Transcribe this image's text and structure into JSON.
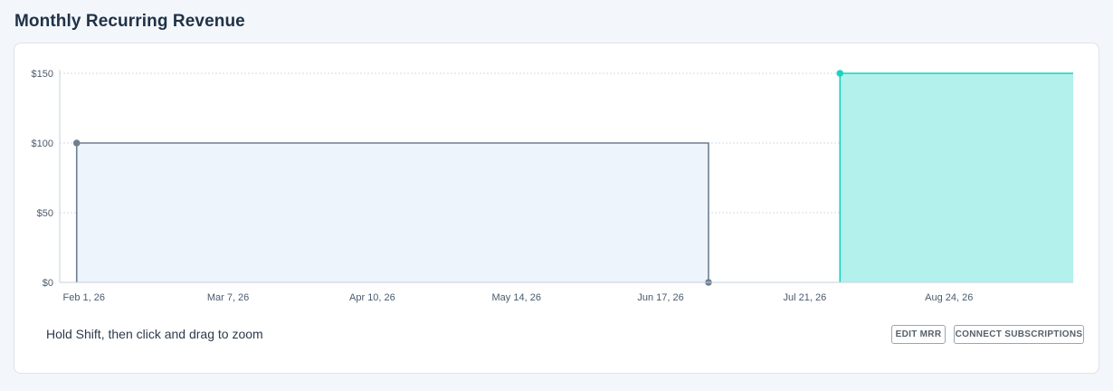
{
  "page": {
    "title": "Monthly Recurring Revenue"
  },
  "footer": {
    "hint": "Hold Shift, then click and drag to zoom",
    "buttons": {
      "edit_mrr": "EDIT MRR",
      "connect_subscriptions": "CONNECT SUBSCRIPTIONS"
    }
  },
  "colors": {
    "series_1_line": "#6e7f90",
    "series_1_fill": "#edf4fc",
    "series_2_line": "#19d3bf",
    "series_2_fill": "#b3f1ed",
    "grid": "#d6dde4",
    "axis": "#c7d0d8"
  },
  "chart_data": {
    "type": "area",
    "step": true,
    "grid": true,
    "legend": "none",
    "y_ticks": [
      "$0",
      "$50",
      "$100",
      "$150"
    ],
    "y_tick_values": [
      0,
      50,
      100,
      150
    ],
    "ylim": [
      0,
      150
    ],
    "x_ticks": [
      "Feb 1, 26",
      "Mar 7, 26",
      "Apr 10, 26",
      "May 14, 26",
      "Jun 17, 26",
      "Jul 21, 26",
      "Aug 24, 26"
    ],
    "x_tick_values": [
      "2026-02-01",
      "2026-03-07",
      "2026-04-10",
      "2026-05-14",
      "2026-06-17",
      "2026-07-21",
      "2026-08-24"
    ],
    "xlim": [
      "2026-01-28",
      "2026-09-24"
    ],
    "series": [
      {
        "points": [
          {
            "x": "2026-02-01",
            "y": 0
          },
          {
            "x": "2026-02-01",
            "y": 100
          },
          {
            "x": "2026-06-30",
            "y": 100
          },
          {
            "x": "2026-06-30",
            "y": 0
          }
        ],
        "markers": [
          {
            "x": "2026-02-01",
            "y": 100
          },
          {
            "x": "2026-06-30",
            "y": 0
          }
        ]
      },
      {
        "points": [
          {
            "x": "2026-07-31",
            "y": 0
          },
          {
            "x": "2026-07-31",
            "y": 150
          },
          {
            "x": "2026-09-24",
            "y": 150
          }
        ],
        "markers": [
          {
            "x": "2026-07-31",
            "y": 150
          }
        ]
      }
    ]
  }
}
